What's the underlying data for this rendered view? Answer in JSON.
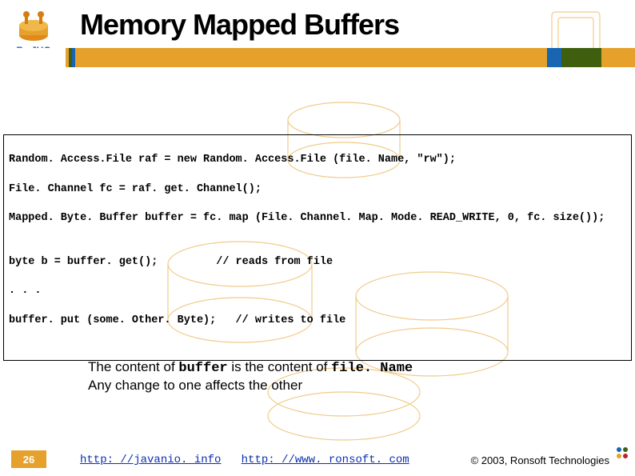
{
  "logo": {
    "text_pre": "Be",
    "text_dot": ".",
    "text_post": "JUG"
  },
  "title": "Memory Mapped Buffers",
  "header_band_colors": [
    "#ffffff",
    "#e5a12b",
    "#3f5f0f",
    "#1765b3",
    "#e5a12b",
    "#1765b3",
    "#3f5f0f",
    "#e5a12b"
  ],
  "header_band_widths": [
    "82px",
    "4px",
    "4px",
    "4px",
    "590px",
    "18px",
    "50px",
    "42px"
  ],
  "code": {
    "l1": "Random. Access.File raf = new Random. Access.File (file. Name, \"rw\");",
    "l2": "File. Channel fc = raf. get. Channel();",
    "l3": "Mapped. Byte. Buffer buffer = fc. map (File. Channel. Map. Mode. READ_WRITE, 0, fc. size());",
    "l4": "",
    "l5": "byte b = buffer. get();         // reads from file",
    "l6": ". . .",
    "l7": "buffer. put (some. Other. Byte);   // writes to file"
  },
  "note": {
    "line1_pre": "The content of ",
    "line1_mono1": "buffer",
    "line1_mid": " is the content of ",
    "line1_mono2": "file. Name",
    "line2": "Any change to one affects the other"
  },
  "footer": {
    "page": "26",
    "link1_text": "http: //javanio. info",
    "link1_href": "http://javanio.info",
    "link2_text": "http: //www. ronsoft. com",
    "link2_href": "http://www.ronsoft.com",
    "copyright": "© 2003, Ronsoft Technologies"
  }
}
